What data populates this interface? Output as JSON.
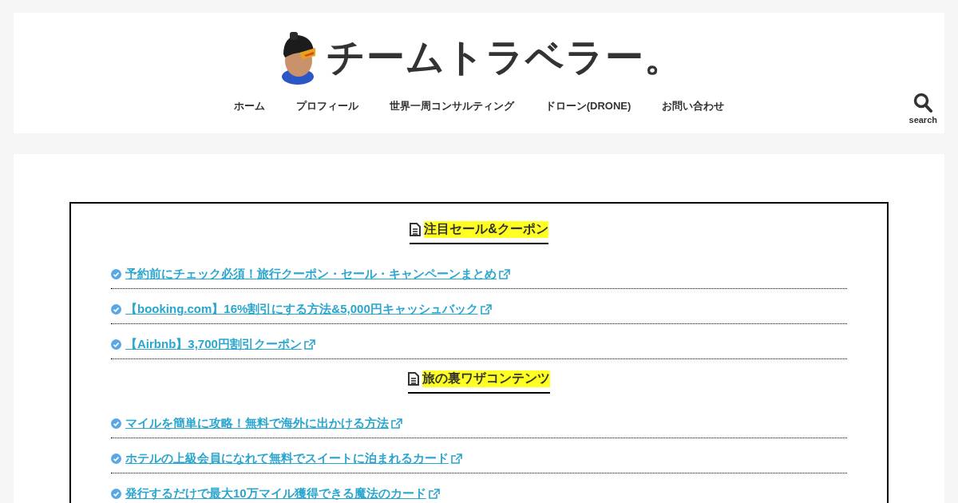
{
  "site": {
    "title": "チームトラベラー。"
  },
  "nav": [
    "ホーム",
    "プロフィール",
    "世界一周コンサルティング",
    "ドローン(DRONE)",
    "お問い合わせ"
  ],
  "search": {
    "label": "search"
  },
  "sections": [
    {
      "heading": "注目セール&クーポン",
      "links": [
        "予約前にチェック必須！旅行クーポン・セール・キャンペーンまとめ",
        "【booking.com】16%割引にする方法&5,000円キャッシュバック",
        "【Airbnb】3,700円割引クーポン"
      ]
    },
    {
      "heading": "旅の裏ワザコンテンツ",
      "links": [
        "マイルを簡単に攻略！無料で海外に出かける方法",
        "ホテルの上級会員になれて無料でスイートに泊まれるカード",
        "発行するだけで最大10万マイル獲得できる魔法のカード"
      ]
    }
  ]
}
